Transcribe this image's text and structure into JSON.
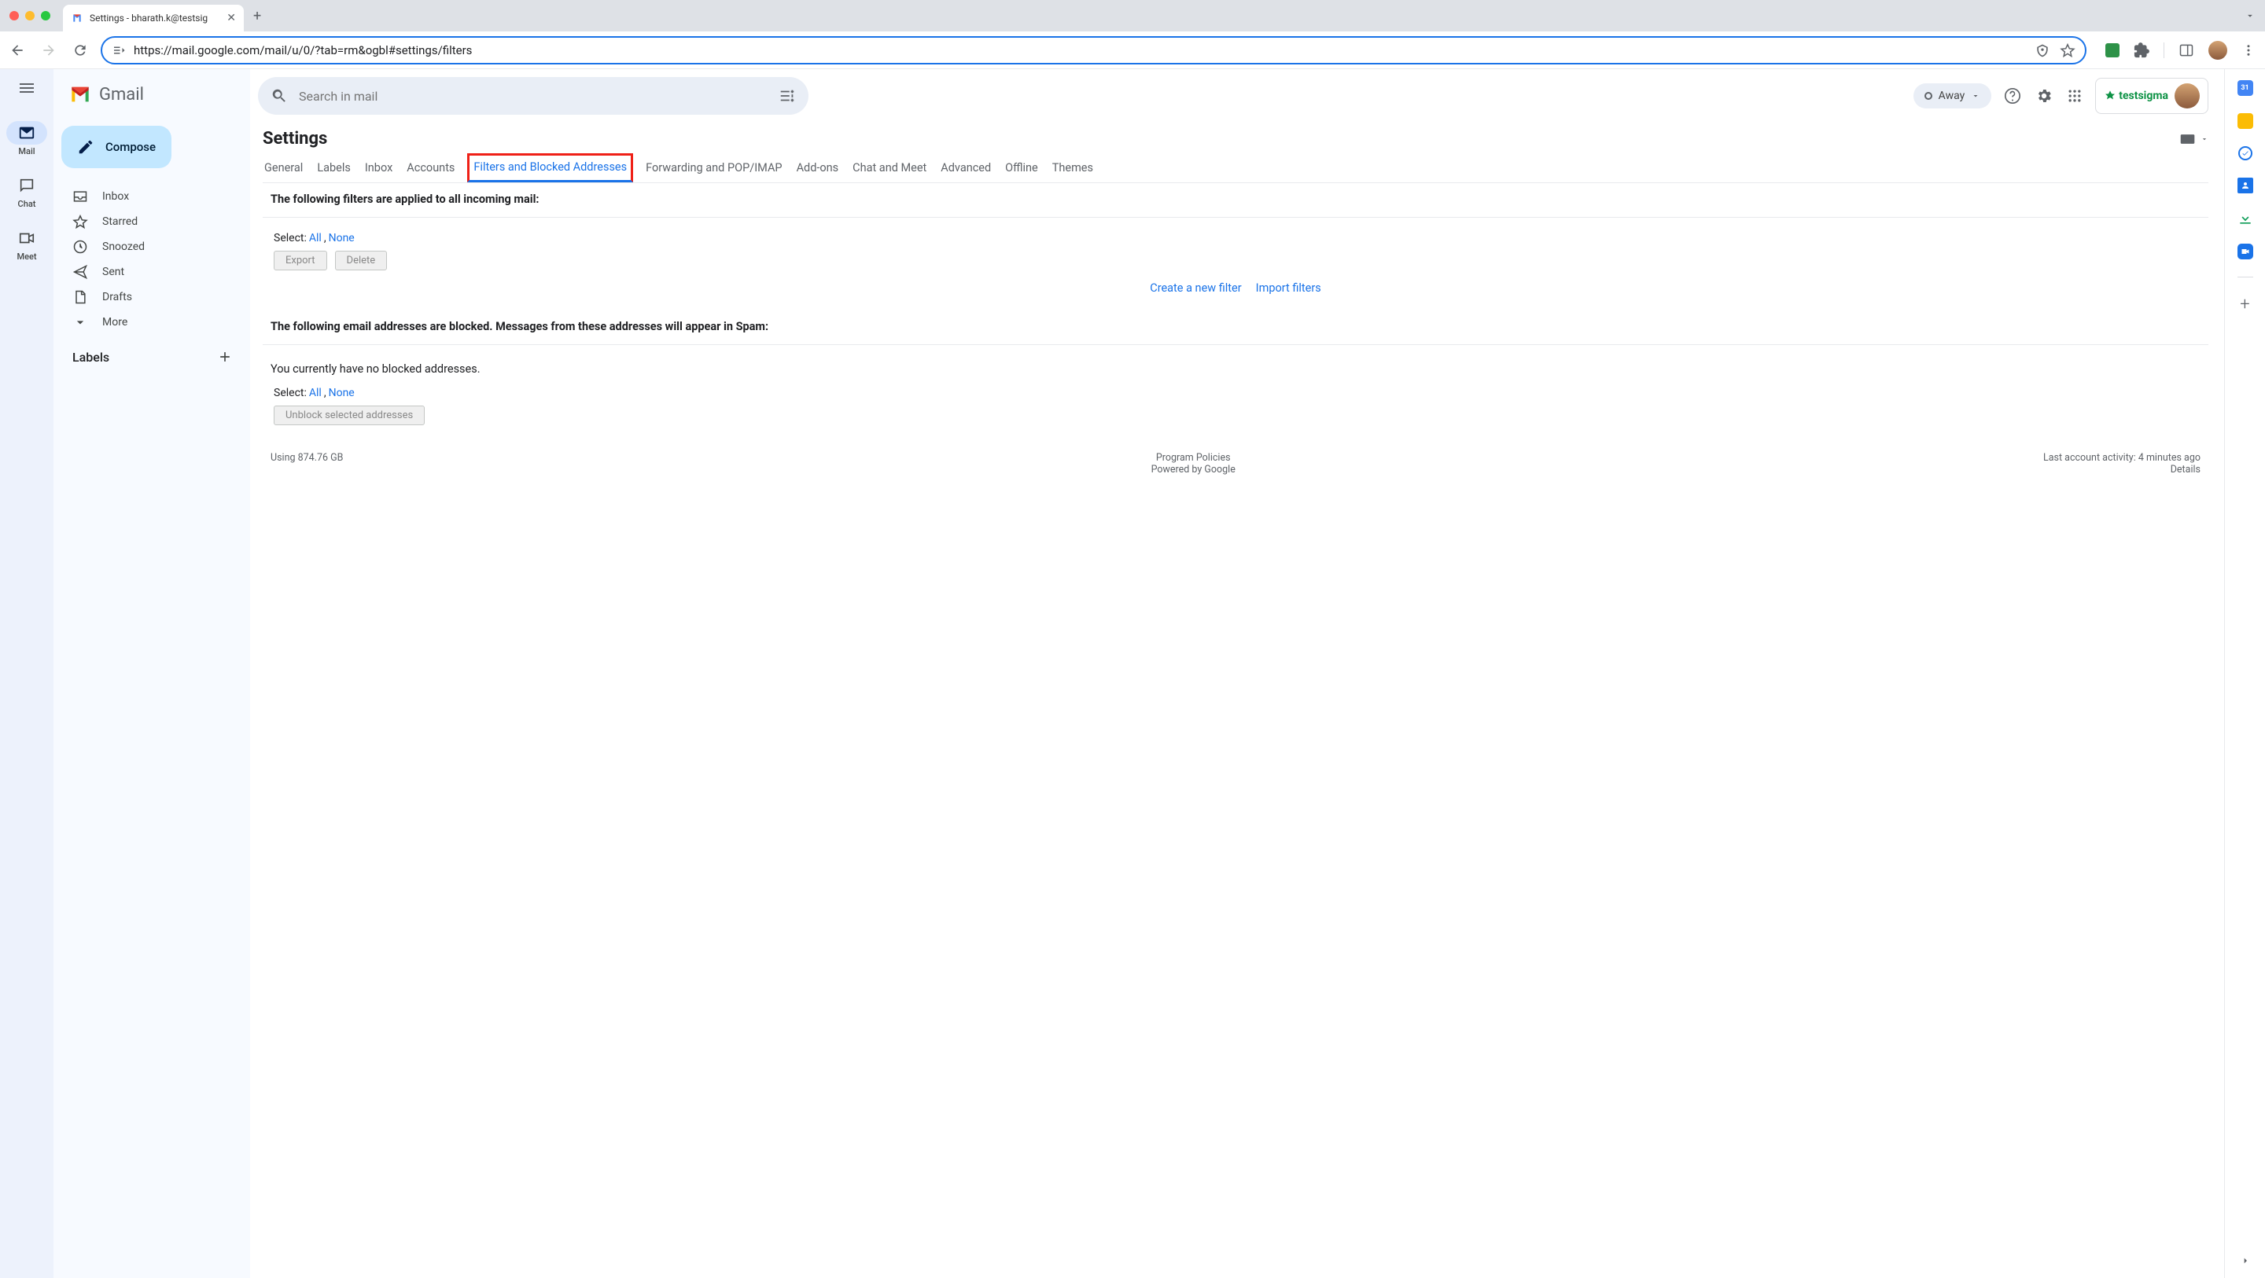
{
  "browser": {
    "tab_title": "Settings - bharath.k@testsig",
    "url": "https://mail.google.com/mail/u/0/?tab=rm&ogbl#settings/filters"
  },
  "app_name": "Gmail",
  "search": {
    "placeholder": "Search in mail"
  },
  "status": {
    "label": "Away"
  },
  "compose_label": "Compose",
  "rail": {
    "mail": "Mail",
    "chat": "Chat",
    "meet": "Meet"
  },
  "nav": {
    "inbox": "Inbox",
    "starred": "Starred",
    "snoozed": "Snoozed",
    "sent": "Sent",
    "drafts": "Drafts",
    "more": "More",
    "labels_header": "Labels"
  },
  "settings": {
    "title": "Settings",
    "tabs": {
      "general": "General",
      "labels": "Labels",
      "inbox": "Inbox",
      "accounts": "Accounts",
      "filters": "Filters and Blocked Addresses",
      "forwarding": "Forwarding and POP/IMAP",
      "addons": "Add-ons",
      "chat": "Chat and Meet",
      "advanced": "Advanced",
      "offline": "Offline",
      "themes": "Themes"
    },
    "filters_heading": "The following filters are applied to all incoming mail:",
    "select_label": "Select:",
    "select_all": "All",
    "select_none": "None",
    "export_btn": "Export",
    "delete_btn": "Delete",
    "create_filter": "Create a new filter",
    "import_filters": "Import filters",
    "blocked_heading": "The following email addresses are blocked. Messages from these addresses will appear in Spam:",
    "no_blocked": "You currently have no blocked addresses.",
    "unblock_btn": "Unblock selected addresses"
  },
  "footer": {
    "storage": "Using 874.76 GB",
    "policies": "Program Policies",
    "powered": "Powered by Google",
    "activity": "Last account activity: 4 minutes ago",
    "details": "Details"
  },
  "brand_chip": "testsigma"
}
